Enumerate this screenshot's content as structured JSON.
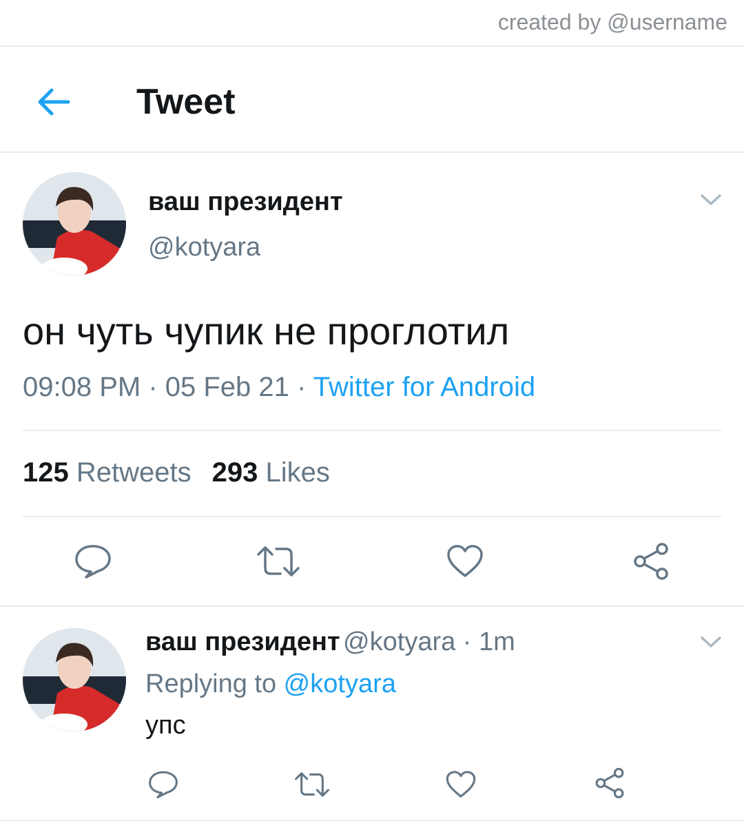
{
  "credit": "created by @username",
  "header": {
    "title": "Tweet"
  },
  "tweet": {
    "author_name": "ваш президент",
    "author_handle": "@kotyara",
    "text": "он чуть чупик не проглотил",
    "time": "09:08 PM",
    "separator": " · ",
    "date": "05 Feb 21",
    "source": "Twitter for Android",
    "retweets_count": "125",
    "retweets_label": "Retweets",
    "likes_count": "293",
    "likes_label": "Likes"
  },
  "reply": {
    "author_name": "ваш президент",
    "author_handle": "@kotyara",
    "time_separator": " · ",
    "time": "1m",
    "replying_to_label": "Replying to ",
    "replying_to_handle": "@kotyara",
    "text": "упс"
  },
  "icons": {
    "back": "arrow-left-icon",
    "chevron": "chevron-down-icon",
    "reply": "speech-bubble-icon",
    "retweet": "retweet-icon",
    "like": "heart-icon",
    "share": "share-icon"
  },
  "colors": {
    "accent": "#1da1f2",
    "icon_gray": "#657786",
    "text_primary": "#14171a",
    "divider": "#e6ecf0",
    "avatar_shirt": "#d62b2b"
  }
}
